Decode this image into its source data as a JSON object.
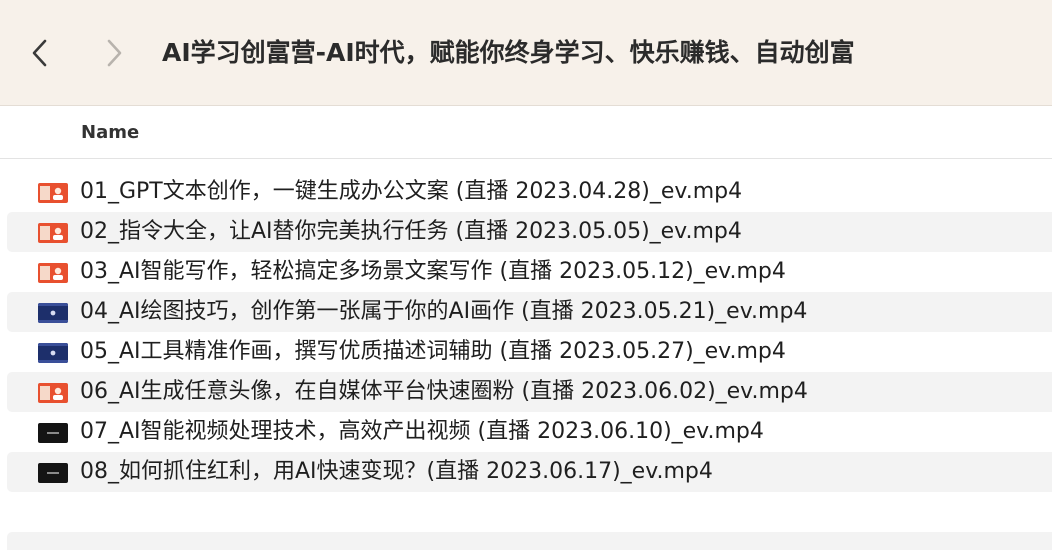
{
  "window": {
    "title": "AI学习创富营-AI时代，赋能你终身学习、快乐赚钱、自动创富"
  },
  "toolbar": {
    "back_icon": "chevron-left-icon",
    "forward_icon": "chevron-right-icon"
  },
  "columns": {
    "name": "Name"
  },
  "files": [
    {
      "name": "01_GPT文本创作，一键生成办公文案 (直播 2023.04.28)_ev.mp4",
      "thumb": "red"
    },
    {
      "name": "02_指令大全，让AI替你完美执行任务 (直播 2023.05.05)_ev.mp4",
      "thumb": "red"
    },
    {
      "name": "03_AI智能写作，轻松搞定多场景文案写作 (直播 2023.05.12)_ev.mp4",
      "thumb": "red"
    },
    {
      "name": "04_AI绘图技巧，创作第一张属于你的AI画作 (直播 2023.05.21)_ev.mp4",
      "thumb": "blue"
    },
    {
      "name": "05_AI工具精准作画，撰写优质描述词辅助 (直播 2023.05.27)_ev.mp4",
      "thumb": "blue"
    },
    {
      "name": "06_AI生成任意头像，在自媒体平台快速圈粉 (直播 2023.06.02)_ev.mp4",
      "thumb": "red"
    },
    {
      "name": "07_AI智能视频处理技术，高效产出视频 (直播 2023.06.10)_ev.mp4",
      "thumb": "dark"
    },
    {
      "name": "08_如何抓住红利，用AI快速变现？(直播 2023.06.17)_ev.mp4",
      "thumb": "dark"
    }
  ],
  "colors": {
    "toolbar_bg": "#f7f1ea",
    "row_alt_bg": "#f3f3f3",
    "thumb_red": "#e8502f",
    "thumb_blue": "#1d2f6b",
    "thumb_dark": "#141414"
  }
}
